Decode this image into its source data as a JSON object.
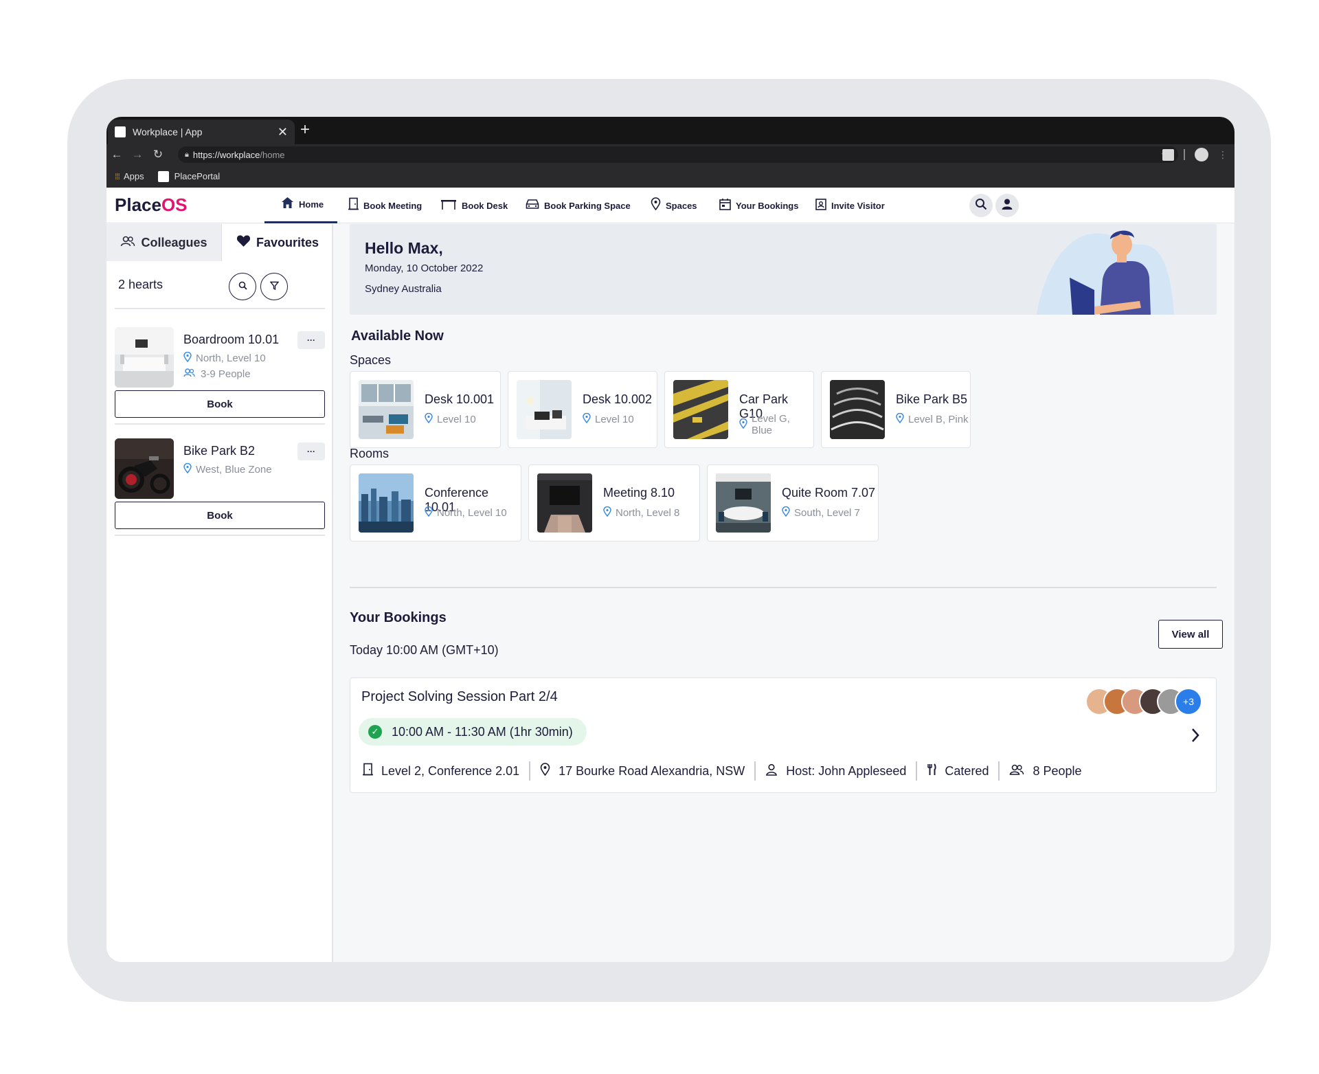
{
  "browser": {
    "tab_title": "Workplace | App",
    "url_host": "https://workplace",
    "url_path": "/home",
    "bookmarks": [
      "Apps",
      "PlacePortal"
    ]
  },
  "header": {
    "logo_place": "Place",
    "logo_os": "OS",
    "nav": [
      {
        "label": "Home",
        "icon": "home-icon"
      },
      {
        "label": "Book Meeting",
        "icon": "door-icon"
      },
      {
        "label": "Book Desk",
        "icon": "desk-icon"
      },
      {
        "label": "Book Parking Space",
        "icon": "car-icon"
      },
      {
        "label": "Spaces",
        "icon": "map-pin-icon"
      },
      {
        "label": "Your Bookings",
        "icon": "calendar-icon"
      },
      {
        "label": "Invite Visitor",
        "icon": "badge-icon"
      }
    ]
  },
  "sidebar": {
    "tabs": [
      "Colleagues",
      "Favourites"
    ],
    "hearts_count": "2 hearts",
    "favourites": [
      {
        "title": "Boardroom 10.01",
        "location": "North, Level 10",
        "capacity": "3-9 People",
        "more": "···",
        "book": "Book"
      },
      {
        "title": "Bike Park B2",
        "location": "West, Blue Zone",
        "more": "···",
        "book": "Book"
      }
    ]
  },
  "greeting": {
    "name": "Hello Max,",
    "date": "Monday, 10 October 2022",
    "location": "Sydney Australia"
  },
  "available": {
    "title": "Available Now",
    "spaces_label": "Spaces",
    "spaces": [
      {
        "title": "Desk 10.001",
        "sub": "Level 10"
      },
      {
        "title": "Desk 10.002",
        "sub": "Level 10"
      },
      {
        "title": "Car Park G10",
        "sub": "Level G, Blue"
      },
      {
        "title": "Bike Park B5",
        "sub": "Level B, Pink"
      }
    ],
    "rooms_label": "Rooms",
    "rooms": [
      {
        "title": "Conference 10.01",
        "sub": "North, Level 10"
      },
      {
        "title": "Meeting 8.10",
        "sub": "North, Level 8"
      },
      {
        "title": "Quite Room 7.07",
        "sub": "South, Level 7"
      }
    ]
  },
  "bookings": {
    "title": "Your Bookings",
    "view_all": "View all",
    "time_heading": "Today 10:00 AM (GMT+10)",
    "item": {
      "title": "Project Solving Session Part 2/4",
      "time": "10:00 AM - 11:30 AM (1hr 30min)",
      "room": "Level 2, Conference 2.01",
      "address": "17 Bourke Road Alexandria, NSW",
      "host": "Host: John Appleseed",
      "catering": "Catered",
      "people": "8 People",
      "extra_attendees": "+3"
    }
  }
}
